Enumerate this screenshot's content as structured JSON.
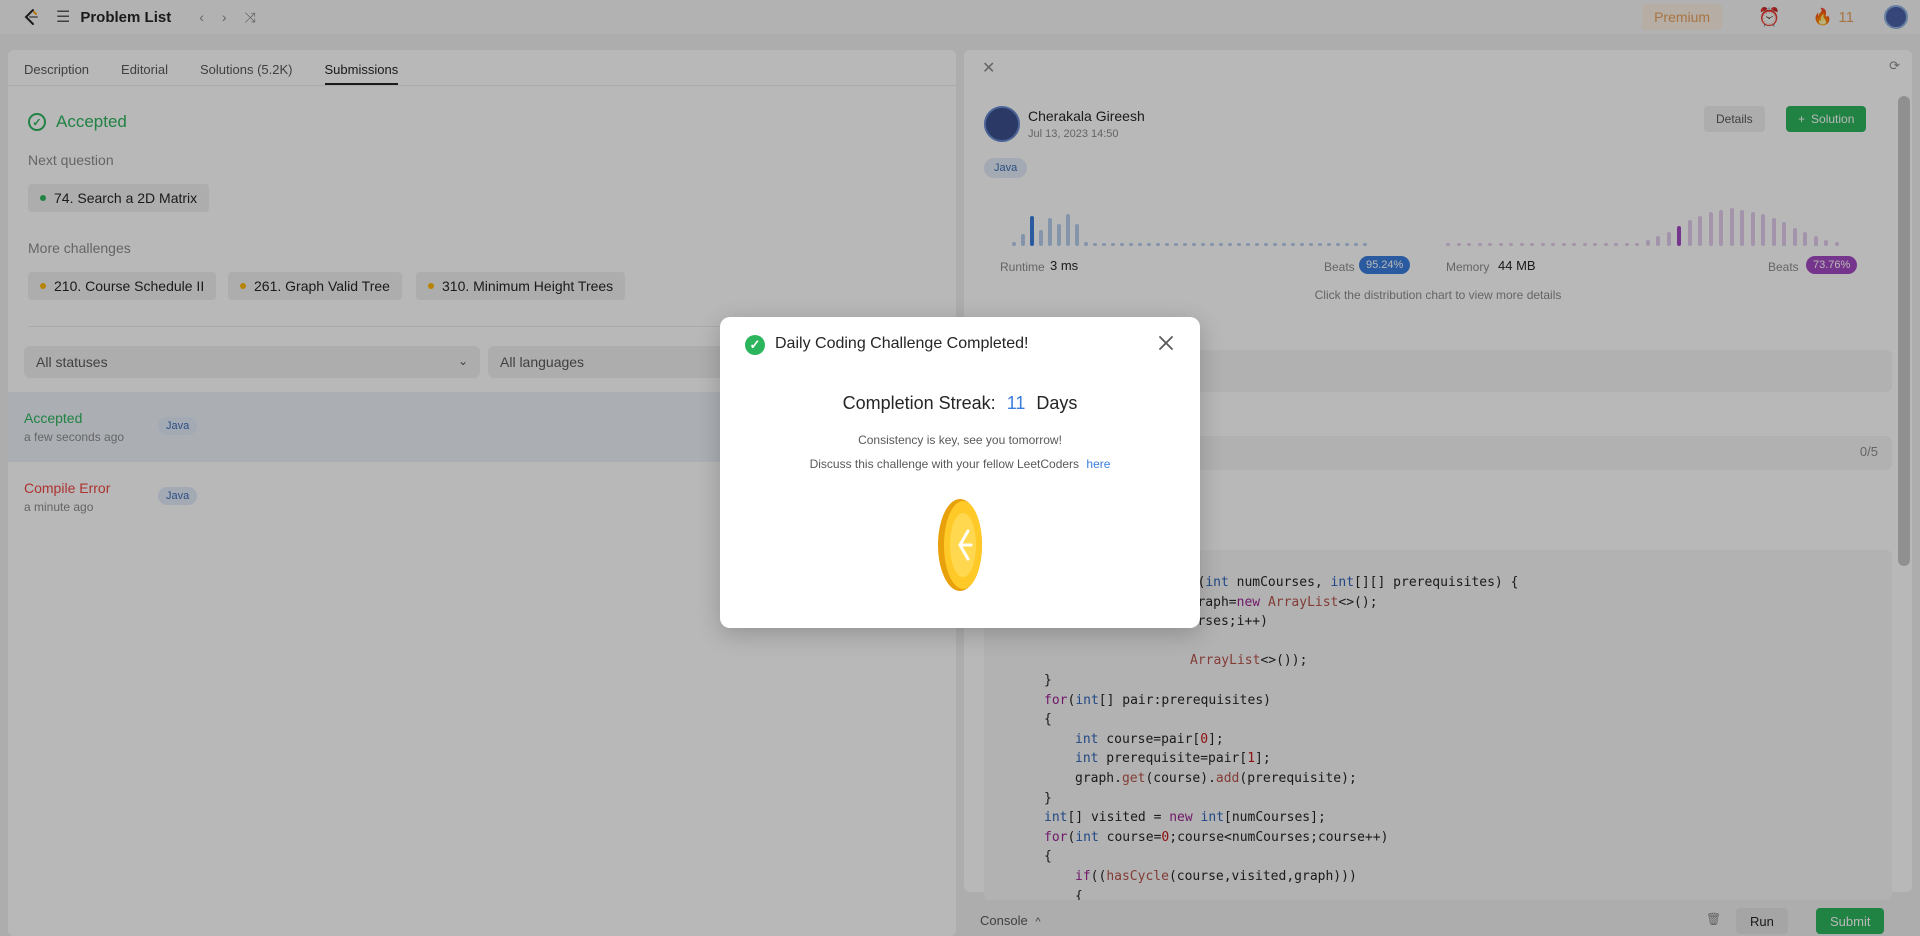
{
  "topbar": {
    "problem_list": "Problem List",
    "premium": "Premium",
    "streak": "11",
    "brand_color": "#ffa116"
  },
  "left": {
    "tabs": [
      "Description",
      "Editorial",
      "Solutions (5.2K)",
      "Submissions"
    ],
    "status_title": "Accepted",
    "next_question_label": "Next question",
    "next_question": "74. Search a 2D Matrix",
    "more_challenges_label": "More challenges",
    "challenges": [
      "210. Course Schedule II",
      "261. Graph Valid Tree",
      "310. Minimum Height Trees"
    ],
    "filters": {
      "status": "All statuses",
      "language": "All languages"
    },
    "submissions": [
      {
        "status": "Accepted",
        "time": "a few seconds ago",
        "lang": "Java",
        "color": "#2db55d"
      },
      {
        "status": "Compile Error",
        "time": "a minute ago",
        "lang": "Java",
        "color": "#ef4743"
      }
    ]
  },
  "right": {
    "user_name": "Cherakala Gireesh",
    "date": "Jul 13, 2023 14:50",
    "details_label": "Details",
    "solution_label": "Solution",
    "language": "Java",
    "runtime_label": "Runtime",
    "runtime_value": "3 ms",
    "runtime_beats_label": "Beats",
    "runtime_beats": "95.24%",
    "memory_label": "Memory",
    "memory_value": "44 MB",
    "memory_beats_label": "Beats",
    "memory_beats": "73.76%",
    "dist_hint": "Click the distribution chart to view more details",
    "testcase_progress": "0/5",
    "code_lines": [
      {
        "indent": 0,
        "tokens": [
          [
            "fn",
            "ish"
          ],
          [
            "",
            "("
          ],
          [
            "kw",
            "int"
          ],
          [
            "",
            " numCourses, "
          ],
          [
            "kw",
            "int"
          ],
          [
            "",
            "[][] prerequisites) {"
          ]
        ],
        "offset": 130
      },
      {
        "indent": 0,
        "tokens": [
          [
            "",
            "> graph="
          ],
          [
            "kw2",
            "new "
          ],
          [
            "fn",
            "ArrayList"
          ],
          [
            "",
            "<>();"
          ]
        ],
        "offset": 130
      },
      {
        "indent": 0,
        "tokens": [
          [
            "",
            "Courses;i++)"
          ]
        ],
        "offset": 130
      },
      {
        "indent": 0,
        "tokens": [
          [
            "",
            ""
          ]
        ],
        "offset": 0
      },
      {
        "indent": 0,
        "tokens": [
          [
            "fn",
            "ArrayList"
          ],
          [
            "",
            "<>());"
          ]
        ],
        "offset": 146
      },
      {
        "indent": 0,
        "tokens": [
          [
            "",
            "}"
          ]
        ],
        "offset": 0
      },
      {
        "indent": 0,
        "tokens": [
          [
            "kw2",
            "for"
          ],
          [
            "",
            "("
          ],
          [
            "kw",
            "int"
          ],
          [
            "",
            "[] pair:prerequisites)"
          ]
        ],
        "offset": 0
      },
      {
        "indent": 0,
        "tokens": [
          [
            "",
            "{"
          ]
        ],
        "offset": 0
      },
      {
        "indent": 1,
        "tokens": [
          [
            "kw",
            "int"
          ],
          [
            "",
            " course=pair["
          ],
          [
            "num",
            "0"
          ],
          [
            "",
            "];"
          ]
        ],
        "offset": 0
      },
      {
        "indent": 1,
        "tokens": [
          [
            "kw",
            "int"
          ],
          [
            "",
            " prerequisite=pair["
          ],
          [
            "num",
            "1"
          ],
          [
            "",
            "];"
          ]
        ],
        "offset": 0
      },
      {
        "indent": 1,
        "tokens": [
          [
            "",
            "graph."
          ],
          [
            "fn",
            "get"
          ],
          [
            "",
            "(course)."
          ],
          [
            "fn",
            "add"
          ],
          [
            "",
            "(prerequisite);"
          ]
        ],
        "offset": 0
      },
      {
        "indent": 0,
        "tokens": [
          [
            "",
            "}"
          ]
        ],
        "offset": 0
      },
      {
        "indent": 0,
        "tokens": [
          [
            "kw",
            "int"
          ],
          [
            "",
            "[] visited = "
          ],
          [
            "kw2",
            "new "
          ],
          [
            "kw",
            "int"
          ],
          [
            "",
            "[numCourses];"
          ]
        ],
        "offset": 0
      },
      {
        "indent": 0,
        "tokens": [
          [
            "kw2",
            "for"
          ],
          [
            "",
            "("
          ],
          [
            "kw",
            "int"
          ],
          [
            "",
            " course="
          ],
          [
            "num",
            "0"
          ],
          [
            "",
            ";course<numCourses;course++)"
          ]
        ],
        "offset": 0
      },
      {
        "indent": 0,
        "tokens": [
          [
            "",
            "{"
          ]
        ],
        "offset": 0
      },
      {
        "indent": 1,
        "tokens": [
          [
            "kw2",
            "if"
          ],
          [
            "",
            "(("
          ],
          [
            "fn",
            "hasCycle"
          ],
          [
            "",
            "(course,visited,graph)))"
          ]
        ],
        "offset": 0
      },
      {
        "indent": 1,
        "tokens": [
          [
            "",
            "{"
          ]
        ],
        "offset": 0
      },
      {
        "indent": 2,
        "tokens": [
          [
            "kw2",
            "return "
          ],
          [
            "kw",
            "false"
          ],
          [
            "",
            ";"
          ]
        ],
        "offset": 0
      },
      {
        "indent": 1,
        "tokens": [
          [
            "",
            "}"
          ]
        ],
        "offset": 0
      }
    ],
    "runtime_bars": [
      4,
      12,
      30,
      16,
      28,
      22,
      32,
      22,
      4,
      3,
      3,
      3,
      3,
      3,
      3,
      3,
      3,
      3,
      3,
      3,
      3,
      3,
      3,
      3,
      3,
      3,
      3,
      3,
      3,
      3,
      3,
      3,
      3,
      3,
      3,
      3,
      3,
      3,
      3,
      3
    ],
    "memory_bars": [
      3,
      3,
      3,
      3,
      3,
      3,
      3,
      3,
      3,
      3,
      3,
      3,
      3,
      3,
      3,
      3,
      3,
      3,
      3,
      6,
      10,
      14,
      20,
      26,
      30,
      34,
      36,
      38,
      36,
      34,
      32,
      28,
      24,
      18,
      14,
      10,
      6,
      4
    ],
    "runtime_highlight_index": 2,
    "memory_highlight_index": 22
  },
  "bottom": {
    "console": "Console",
    "run": "Run",
    "submit": "Submit"
  },
  "modal": {
    "title": "Daily Coding Challenge Completed!",
    "streak_label": "Completion Streak:",
    "streak_value": "11",
    "streak_unit": "Days",
    "line1": "Consistency is key, see you tomorrow!",
    "line2": "Discuss this challenge with your fellow LeetCoders",
    "link": "here"
  }
}
